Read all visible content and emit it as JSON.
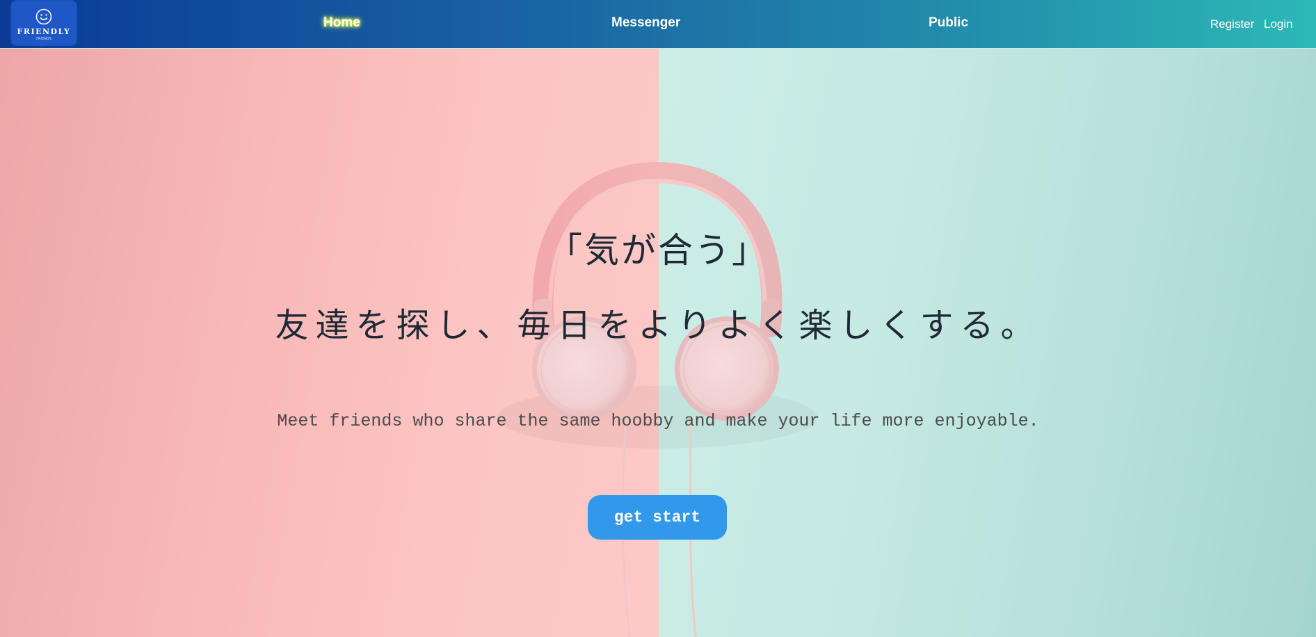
{
  "navbar": {
    "logo": {
      "text": "FRIENDLY",
      "subtext": "FRIENDS",
      "icon": "smiley-face-icon"
    },
    "links": [
      {
        "label": "Home",
        "active": true
      },
      {
        "label": "Messenger",
        "active": false
      },
      {
        "label": "Public",
        "active": false
      }
    ],
    "auth": {
      "register_label": "Register",
      "login_label": "Login"
    }
  },
  "hero": {
    "title": "「気が合う」",
    "subtitle": "友達を探し、毎日をよりよく楽しくする。",
    "description": "Meet friends who share the same hoobby and make your life more enjoyable.",
    "cta_label": "get start",
    "background_image": "pink-headphones-on-pink-and-mint-background"
  },
  "colors": {
    "navbar_gradient_start": "#0a3b97",
    "navbar_gradient_end": "#2cb9b6",
    "logo_bg": "#2057c6",
    "bg_left": "#fcc5c3",
    "bg_right": "#c6e9e3",
    "cta_bg": "#3298ea",
    "heading_text": "#1f2935",
    "active_glow": "#e7ff63"
  }
}
